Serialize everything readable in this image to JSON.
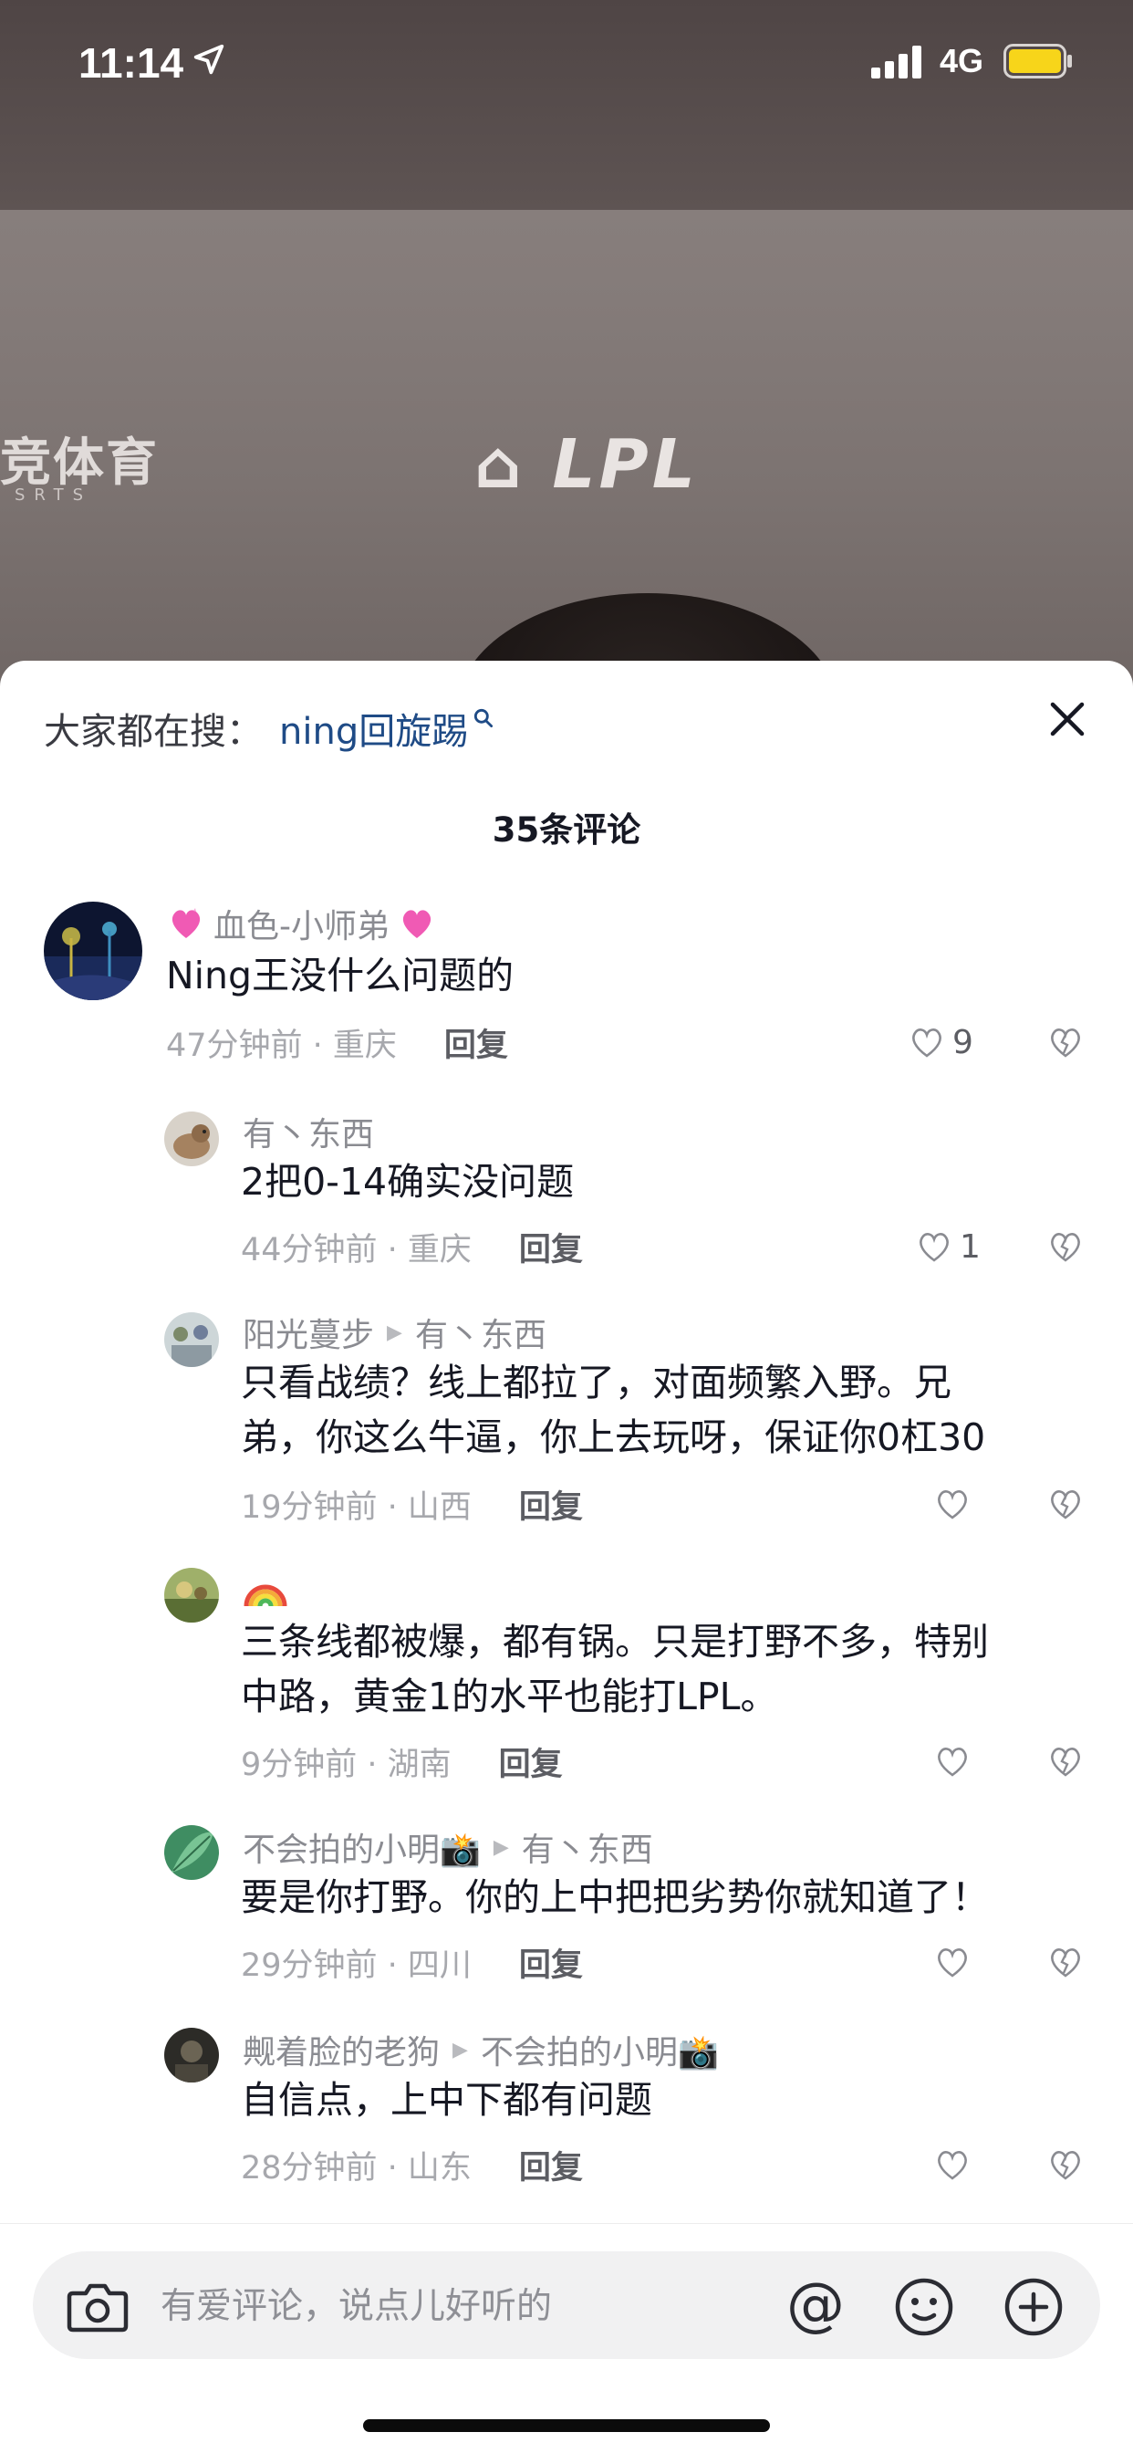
{
  "status_bar": {
    "time": "11:14",
    "network": "4G"
  },
  "video": {
    "brand_left": "竞体育",
    "brand_left_sub": "SRTS",
    "brand_center": "LPL"
  },
  "search_suggest": {
    "prefix": "大家都在搜：",
    "term": "ning回旋踢"
  },
  "comments_header": {
    "count_label": "35条评论"
  },
  "comments": [
    {
      "name": "血色-小师弟",
      "text": "Ning王没什么问题的",
      "time": "47分钟前 · 重庆",
      "reply": "回复",
      "likes": "9"
    },
    {
      "name": "有丶东西",
      "text": "2把0-14确实没问题",
      "time": "44分钟前 · 重庆",
      "reply": "回复",
      "likes": "1"
    },
    {
      "name": "阳光蔓步",
      "reply_to": "有丶东西",
      "text_line1": "只看战绩？线上都拉了，对面频繁入野。兄",
      "text_line2": "弟，你这么牛逼，你上去玩呀，保证你0杠30",
      "time": "19分钟前 · 山西",
      "reply": "回复"
    },
    {
      "name": "🌈",
      "text_line1": "三条线都被爆，都有锅。只是打野不多，特别",
      "text_line2": "中路，黄金1的水平也能打LPL。",
      "time": "9分钟前 · 湖南",
      "reply": "回复"
    },
    {
      "name": "不会拍的小明📸",
      "reply_to": "有丶东西",
      "text": "要是你打野。你的上中把把劣势你就知道了！",
      "time": "29分钟前 · 四川",
      "reply": "回复"
    },
    {
      "name": "觍着脸的老狗",
      "reply_to": "不会拍的小明📸",
      "text": "自信点，上中下都有问题",
      "time": "28分钟前 · 山东",
      "reply": "回复"
    }
  ],
  "input": {
    "placeholder": "有爱评论，说点儿好听的",
    "at_symbol": "@"
  }
}
